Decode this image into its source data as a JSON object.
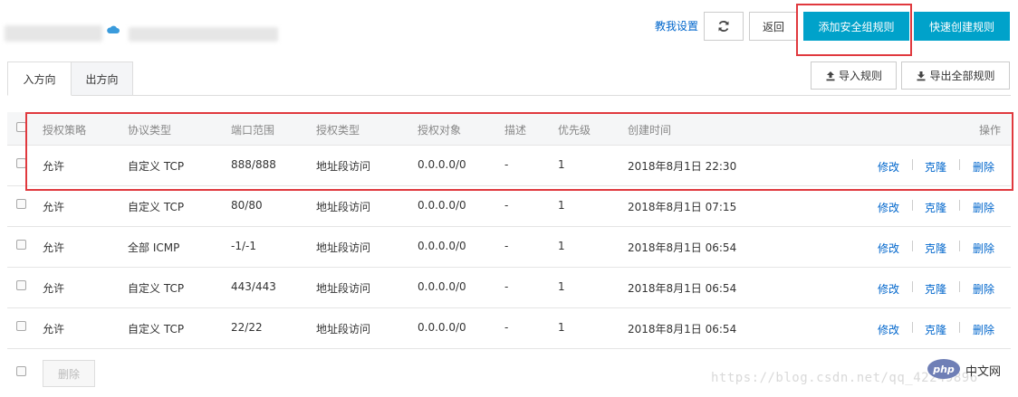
{
  "header": {
    "help_link": "教我设置",
    "back_button": "返回",
    "add_rule_button": "添加安全组规则",
    "quick_create_button": "快速创建规则",
    "refresh_icon": "refresh-icon",
    "cloud_icon": "cloud-icon"
  },
  "tabs": [
    {
      "label": "入方向",
      "active": true
    },
    {
      "label": "出方向",
      "active": false
    }
  ],
  "toolbar": {
    "import_button": "导入规则",
    "export_button": "导出全部规则",
    "import_icon": "upload-icon",
    "export_icon": "download-icon"
  },
  "table": {
    "columns": [
      "授权策略",
      "协议类型",
      "端口范围",
      "授权类型",
      "授权对象",
      "描述",
      "优先级",
      "创建时间",
      "操作"
    ],
    "rows": [
      {
        "policy": "允许",
        "protocol": "自定义 TCP",
        "port": "888/888",
        "auth_type": "地址段访问",
        "auth_object": "0.0.0.0/0",
        "desc": "-",
        "priority": "1",
        "created": "2018年8月1日 22:30"
      },
      {
        "policy": "允许",
        "protocol": "自定义 TCP",
        "port": "80/80",
        "auth_type": "地址段访问",
        "auth_object": "0.0.0.0/0",
        "desc": "-",
        "priority": "1",
        "created": "2018年8月1日 07:15"
      },
      {
        "policy": "允许",
        "protocol": "全部 ICMP",
        "port": "-1/-1",
        "auth_type": "地址段访问",
        "auth_object": "0.0.0.0/0",
        "desc": "-",
        "priority": "1",
        "created": "2018年8月1日 06:54"
      },
      {
        "policy": "允许",
        "protocol": "自定义 TCP",
        "port": "443/443",
        "auth_type": "地址段访问",
        "auth_object": "0.0.0.0/0",
        "desc": "-",
        "priority": "1",
        "created": "2018年8月1日 06:54"
      },
      {
        "policy": "允许",
        "protocol": "自定义 TCP",
        "port": "22/22",
        "auth_type": "地址段访问",
        "auth_object": "0.0.0.0/0",
        "desc": "-",
        "priority": "1",
        "created": "2018年8月1日 06:54"
      }
    ],
    "row_actions": {
      "edit": "修改",
      "clone": "克隆",
      "delete": "删除"
    }
  },
  "footer": {
    "bulk_delete_button": "删除",
    "watermark": "https://blog.csdn.net/qq_42249896",
    "php_logo": "php",
    "php_site": "中文网"
  },
  "colors": {
    "primary": "#00a2ca",
    "link": "#0066cc",
    "highlight_box": "#e0393e"
  }
}
